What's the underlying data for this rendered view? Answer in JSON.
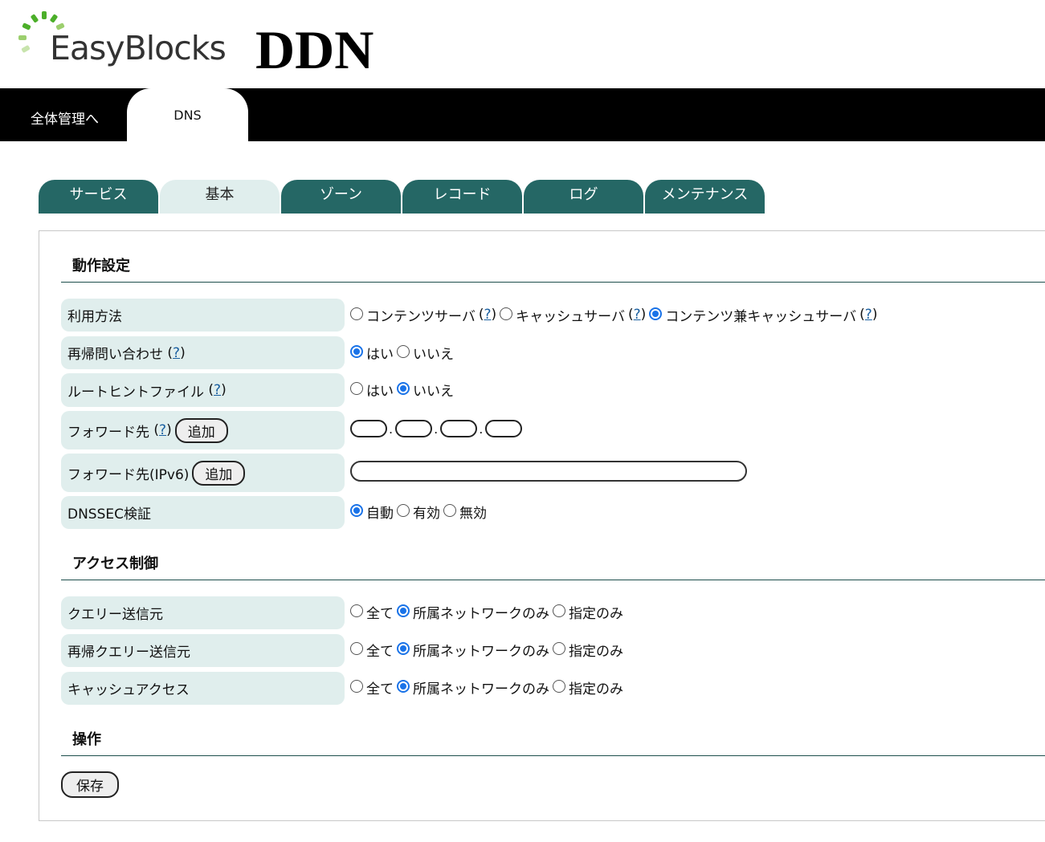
{
  "header": {
    "logo_text": "EasyBlocks",
    "title": "DDN"
  },
  "top_tabs": [
    {
      "label": "全体管理へ"
    },
    {
      "label": "DNS"
    }
  ],
  "sub_tabs": [
    {
      "label": "サービス"
    },
    {
      "label": "基本"
    },
    {
      "label": "ゾーン"
    },
    {
      "label": "レコード"
    },
    {
      "label": "ログ"
    },
    {
      "label": "メンテナンス"
    }
  ],
  "sections": {
    "operation": "動作設定",
    "access": "アクセス制御",
    "actions": "操作"
  },
  "help_mark": "?",
  "operation": {
    "usage": {
      "label": "利用方法",
      "options": [
        "コンテンツサーバ",
        "キャッシュサーバ",
        "コンテンツ兼キャッシュサーバ"
      ]
    },
    "recursion": {
      "label": "再帰問い合わせ",
      "options": [
        "はい",
        "いいえ"
      ]
    },
    "root_hint": {
      "label": "ルートヒントファイル",
      "options": [
        "はい",
        "いいえ"
      ]
    },
    "forward": {
      "label": "フォワード先",
      "add_label": "追加",
      "separator": "."
    },
    "forward6": {
      "label": "フォワード先(IPv6)",
      "add_label": "追加"
    },
    "dnssec": {
      "label": "DNSSEC検証",
      "options": [
        "自動",
        "有効",
        "無効"
      ]
    }
  },
  "access": {
    "query_source": {
      "label": "クエリー送信元",
      "options": [
        "全て",
        "所属ネットワークのみ",
        "指定のみ"
      ]
    },
    "recursive_source": {
      "label": "再帰クエリー送信元",
      "options": [
        "全て",
        "所属ネットワークのみ",
        "指定のみ"
      ]
    },
    "cache_access": {
      "label": "キャッシュアクセス",
      "options": [
        "全て",
        "所属ネットワークのみ",
        "指定のみ"
      ]
    }
  },
  "actions": {
    "save_label": "保存"
  },
  "colors": {
    "tab": "#256765",
    "tab_active": "#e0eeed",
    "label_bg": "#e0eeed",
    "radio_on": "#1a73e8"
  }
}
